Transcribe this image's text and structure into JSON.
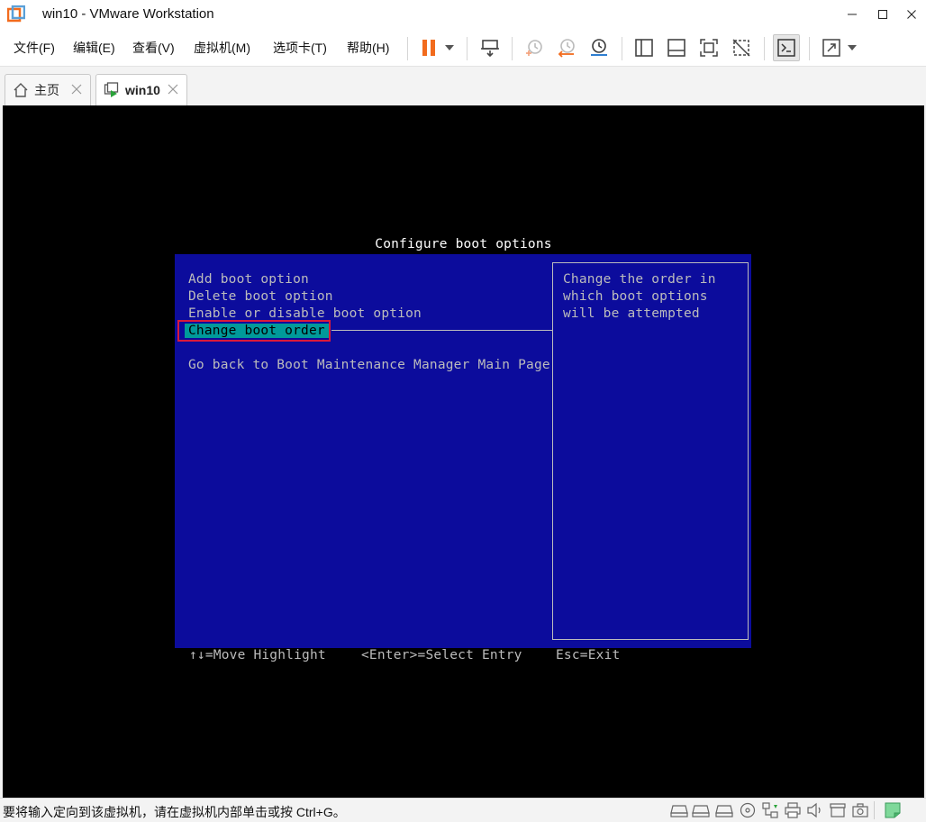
{
  "window": {
    "title": "win10 - VMware Workstation"
  },
  "menu": {
    "items": [
      "文件(F)",
      "编辑(E)",
      "查看(V)",
      "虚拟机(M)",
      "选项卡(T)",
      "帮助(H)"
    ]
  },
  "toolbar": {
    "icons": [
      "pause-icon",
      "dropdown-icon",
      "send-keys-icon",
      "snapshot-icon",
      "revert-snapshot-icon",
      "snapshot-manager-icon",
      "sidebar-icon",
      "thumbnail-icon",
      "fullscreen-icon",
      "unity-icon",
      "console-icon",
      "stretch-icon",
      "dropdown-icon"
    ],
    "accent_color": "#f26b1d"
  },
  "tabs": [
    {
      "label": "主页",
      "icon": "home-icon",
      "active": false
    },
    {
      "label": "win10",
      "icon": "vm-running-icon",
      "active": true
    }
  ],
  "bios": {
    "title": "Configure boot options",
    "options": [
      {
        "label": "Add boot option",
        "selected": false
      },
      {
        "label": "Delete boot option",
        "selected": false
      },
      {
        "label": "Enable or disable boot option",
        "selected": false
      },
      {
        "label": "Change boot order",
        "selected": true
      },
      {
        "label": "Go back to Boot Maintenance Manager Main Page",
        "selected": false
      }
    ],
    "help_lines": [
      "Change the order in",
      "which boot options",
      "will be attempted"
    ],
    "footer": {
      "move": "↑↓=Move Highlight",
      "select": "<Enter>=Select Entry",
      "exit": "Esc=Exit"
    },
    "panel_color": "#0c0c9c",
    "highlight_color": "#009a9a"
  },
  "status": {
    "message": "要将输入定向到该虚拟机，请在虚拟机内部单击或按 Ctrl+G。",
    "icons": [
      "hdd-icon",
      "hdd-icon",
      "hdd-icon",
      "cd-icon",
      "network-icon",
      "usb-icon",
      "printer-icon",
      "sound-icon",
      "display-icon",
      "camera-icon",
      "message-icon"
    ]
  }
}
